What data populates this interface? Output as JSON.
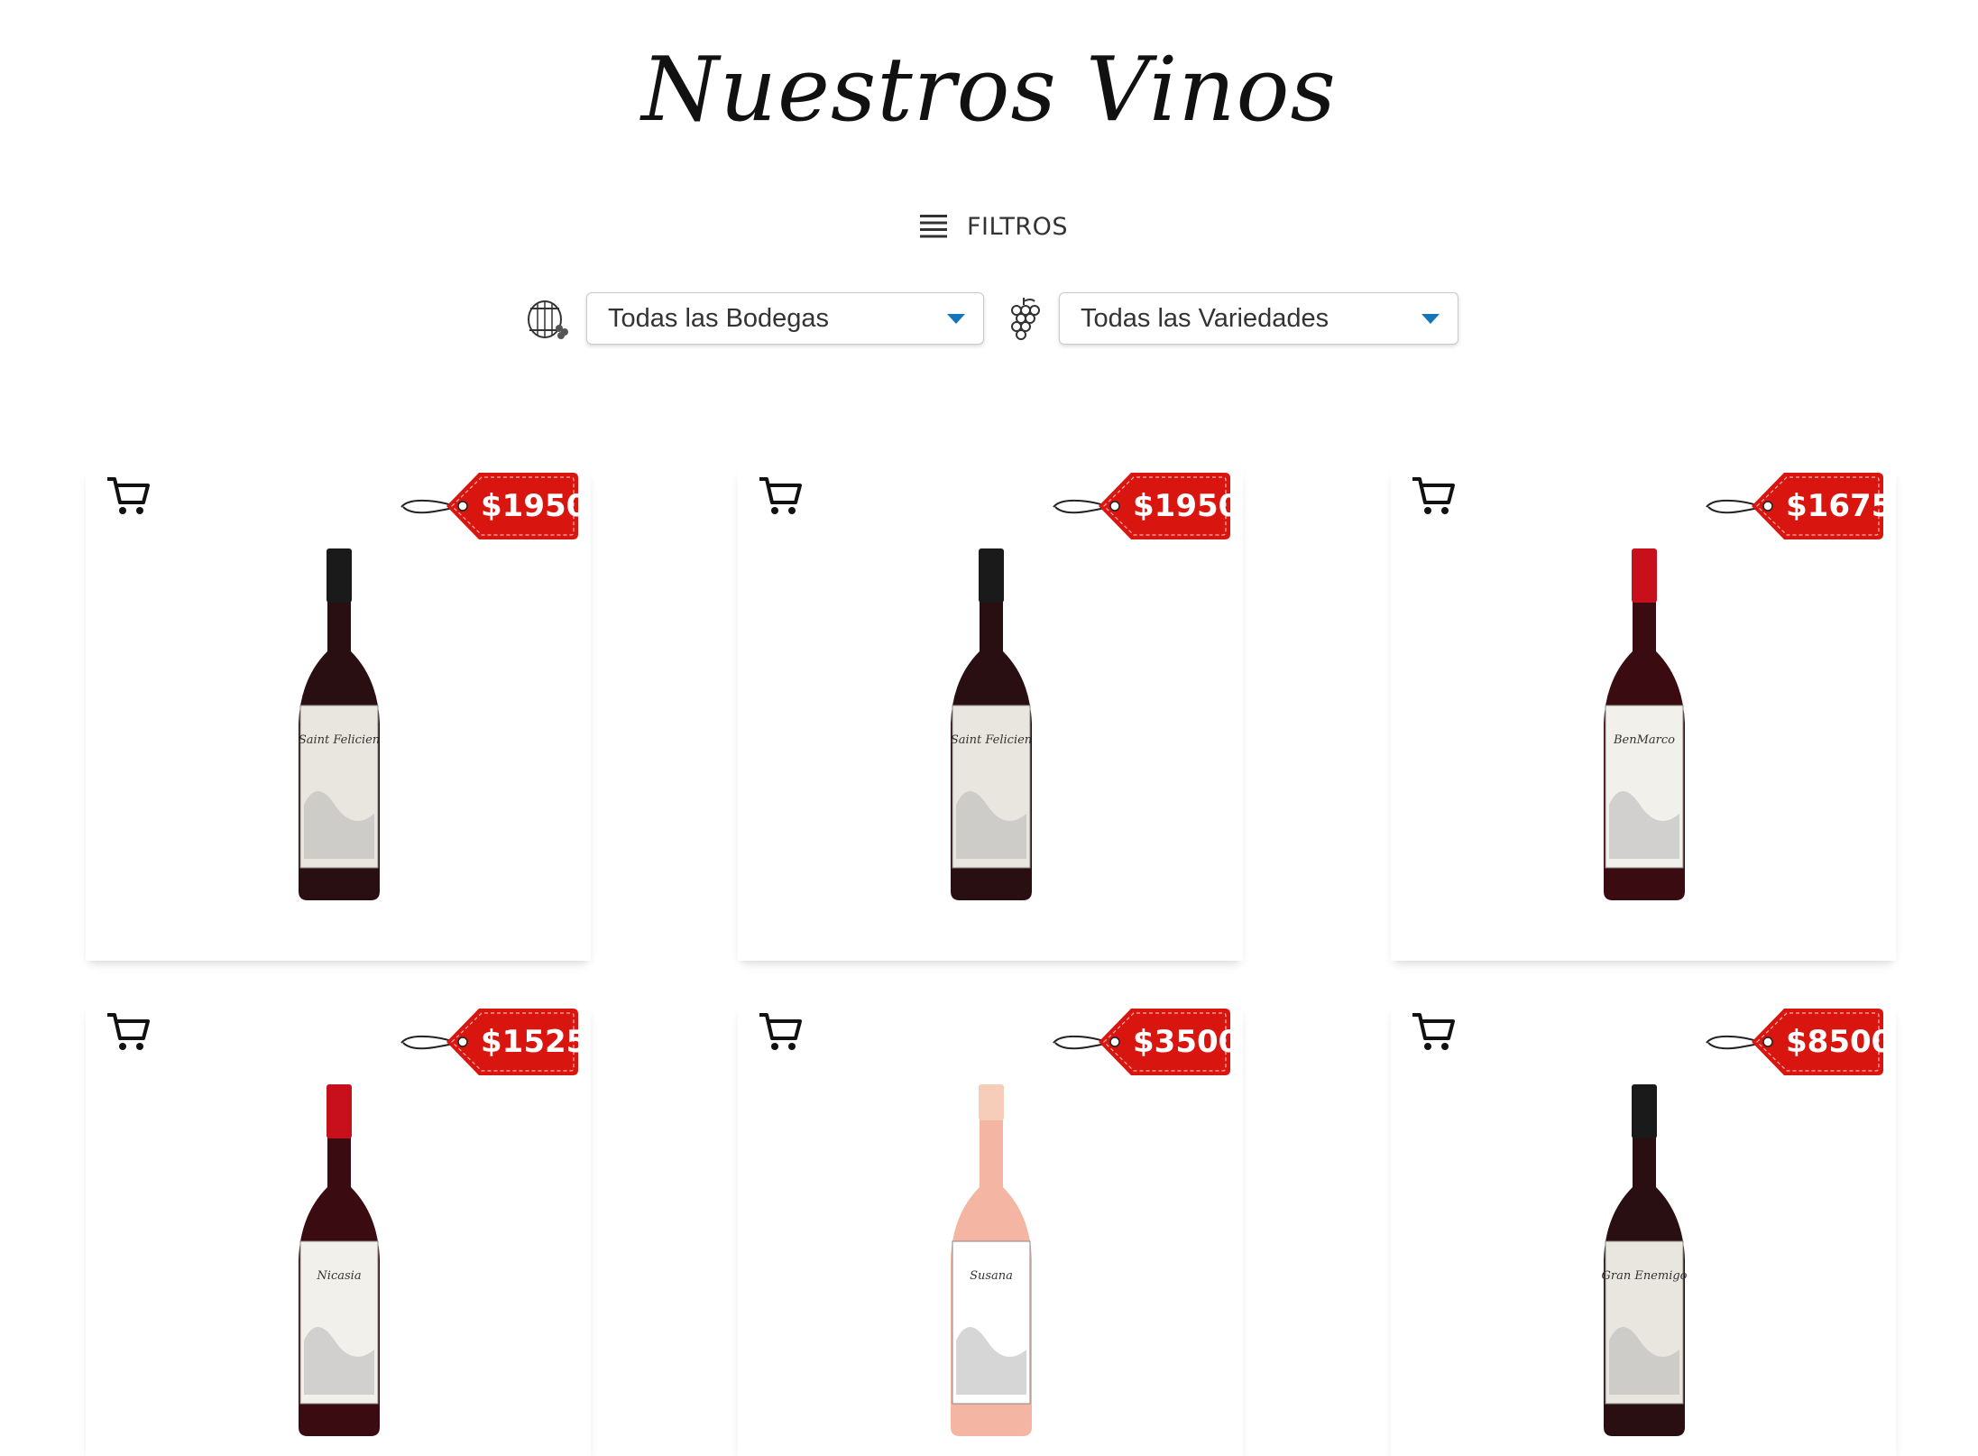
{
  "page": {
    "title": "Nuestros Vinos"
  },
  "filters": {
    "toggle_label": "FILTROS",
    "bodegas": {
      "selected": "Todas las Bodegas",
      "icon": "barrel-icon"
    },
    "variedades": {
      "selected": "Todas las Variedades",
      "icon": "grapes-icon"
    }
  },
  "colors": {
    "price_tag": "#d9150f",
    "caret": "#1476b8"
  },
  "products": [
    {
      "price": "$1950",
      "label_text": "Saint Felicien",
      "bottle": "dark"
    },
    {
      "price": "$1950",
      "label_text": "Saint Felicien",
      "bottle": "dark"
    },
    {
      "price": "$1675",
      "label_text": "BenMarco",
      "bottle": "red-capsule"
    },
    {
      "price": "$1525",
      "label_text": "Nicasia",
      "bottle": "red-capsule"
    },
    {
      "price": "$3500",
      "label_text": "Susana",
      "bottle": "rose"
    },
    {
      "price": "$8500",
      "label_text": "Gran Enemigo",
      "bottle": "dark"
    }
  ]
}
